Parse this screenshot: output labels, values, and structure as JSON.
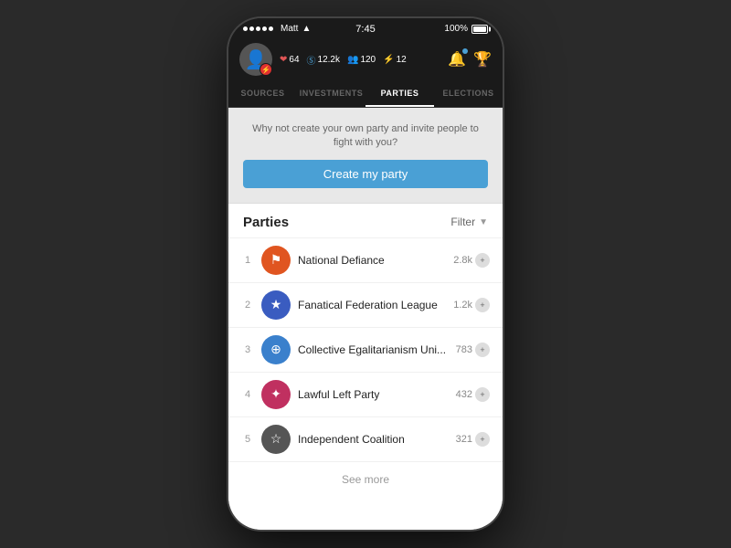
{
  "statusBar": {
    "carrier": "Matt",
    "time": "7:45",
    "battery": "100%"
  },
  "header": {
    "stats": [
      {
        "id": "likes",
        "value": "64",
        "icon": "❤"
      },
      {
        "id": "money",
        "value": "12.2k",
        "icon": "💲"
      },
      {
        "id": "people",
        "value": "120",
        "icon": "👤"
      },
      {
        "id": "lightning",
        "value": "12",
        "icon": "⚡"
      }
    ]
  },
  "navTabs": [
    {
      "id": "sources",
      "label": "SOURCES",
      "active": false
    },
    {
      "id": "investments",
      "label": "INVESTMENTS",
      "active": false
    },
    {
      "id": "parties",
      "label": "PARTIES",
      "active": true
    },
    {
      "id": "elections",
      "label": "ELECTIONS",
      "active": false
    }
  ],
  "promo": {
    "text": "Why not create your own party and invite people to fight with you?",
    "buttonLabel": "Create my party"
  },
  "partiesSection": {
    "title": "Parties",
    "filterLabel": "Filter",
    "items": [
      {
        "rank": "1",
        "name": "National Defiance",
        "count": "2.8k",
        "bgColor": "#e05520",
        "iconSymbol": "⚐"
      },
      {
        "rank": "2",
        "name": "Fanatical Federation League",
        "count": "1.2k",
        "bgColor": "#4055c0",
        "iconSymbol": "★"
      },
      {
        "rank": "3",
        "name": "Collective Egalitarianism Uni...",
        "count": "783",
        "bgColor": "#3a80cc",
        "iconSymbol": "⊕"
      },
      {
        "rank": "4",
        "name": "Lawful Left Party",
        "count": "432",
        "bgColor": "#c03060",
        "iconSymbol": "✦"
      },
      {
        "rank": "5",
        "name": "Independent Coalition",
        "count": "321",
        "bgColor": "#555",
        "iconSymbol": "☆"
      }
    ],
    "seeMoreLabel": "See more"
  }
}
